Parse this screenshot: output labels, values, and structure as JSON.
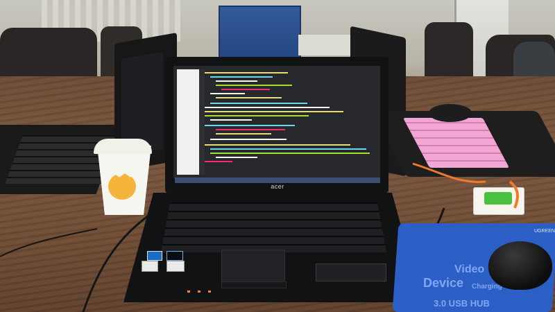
{
  "scene": {
    "laptop_brand_label": "acer",
    "mousepad": {
      "brand": "UGREEN",
      "texts": [
        "Video",
        "Device",
        "Charging",
        "3.0 USB HUB"
      ]
    }
  },
  "colors": {
    "table": "#6d4a33",
    "screen_bg": "#27282c",
    "mousepad": "#2c5fc6",
    "keyboard_cover": "#f2a6d4"
  }
}
